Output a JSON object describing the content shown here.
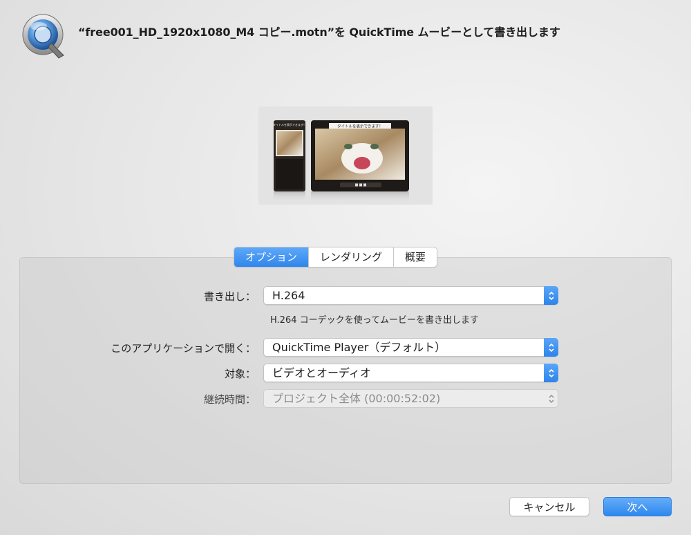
{
  "window": {
    "title": "“free001_HD_1920x1080_M4 コピー.motn”を QuickTime ムービーとして書き出します",
    "app_icon": "quicktime-logo-icon"
  },
  "preview": {
    "caption_small": "タイトルを表示できます！",
    "caption_large": "タイトルを表示できます！"
  },
  "tabs": [
    {
      "label": "オプション",
      "active": true
    },
    {
      "label": "レンダリング",
      "active": false
    },
    {
      "label": "概要",
      "active": false
    }
  ],
  "options": {
    "export_label": "書き出し：",
    "export_value": "H.264",
    "export_hint": "H.264 コーデックを使ってムービーを書き出します",
    "open_with_label": "このアプリケーションで開く：",
    "open_with_value": "QuickTime Player（デフォルト）",
    "include_label": "対象：",
    "include_value": "ビデオとオーディオ",
    "duration_label": "継続時間：",
    "duration_value": "プロジェクト全体 (00:00:52:02)",
    "duration_enabled": false
  },
  "buttons": {
    "cancel": "キャンセル",
    "next": "次へ"
  },
  "colors": {
    "accent": "#2e86ec",
    "disabled_text": "#8a8a8a"
  }
}
